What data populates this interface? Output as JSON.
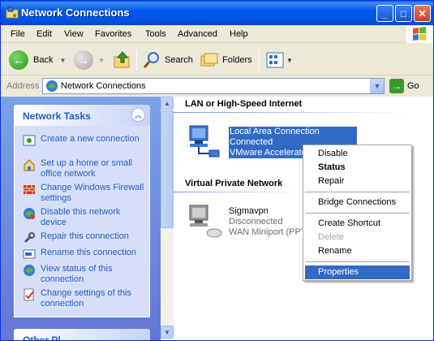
{
  "window": {
    "title": "Network Connections",
    "controls": {
      "minimize": "_",
      "maximize": "□",
      "close": "✕"
    }
  },
  "menu": [
    "File",
    "Edit",
    "View",
    "Favorites",
    "Tools",
    "Advanced",
    "Help"
  ],
  "toolbar": {
    "back": "Back",
    "search": "Search",
    "folders": "Folders"
  },
  "address": {
    "label": "Address",
    "value": "Network Connections",
    "go": "Go"
  },
  "left_pane": {
    "network_tasks_title": "Network Tasks",
    "tasks": [
      {
        "label": "Create a new connection",
        "icon": "new-connection-icon"
      },
      {
        "label": "Set up a home or small office network",
        "icon": "home-network-icon"
      },
      {
        "label": "Change Windows Firewall settings",
        "icon": "firewall-icon"
      },
      {
        "label": "Disable this network device",
        "icon": "disable-network-icon"
      },
      {
        "label": "Repair this connection",
        "icon": "repair-icon"
      },
      {
        "label": "Rename this connection",
        "icon": "rename-icon"
      },
      {
        "label": "View status of this connection",
        "icon": "status-icon"
      },
      {
        "label": "Change settings of this connection",
        "icon": "settings-icon"
      }
    ],
    "other_places_title": "Other Pl..."
  },
  "content": {
    "group1": "LAN or High-Speed Internet",
    "lan": {
      "name": "Local Area Connection",
      "status": "Connected",
      "device": "VMware Accelerate"
    },
    "group2": "Virtual Private Network",
    "vpn": {
      "name": "Sigmavpn",
      "status": "Disconnected",
      "device": "WAN Miniport (PPT"
    }
  },
  "context_menu": {
    "items": [
      "Disable",
      "Status",
      "Repair",
      "Bridge Connections",
      "Create Shortcut",
      "Delete",
      "Rename",
      "Properties"
    ],
    "bold": "Status",
    "disabled": "Delete",
    "highlighted": "Properties"
  },
  "colors": {
    "titlebar": "#0055e5",
    "task_link": "#215dc6",
    "selection": "#316ac5"
  }
}
